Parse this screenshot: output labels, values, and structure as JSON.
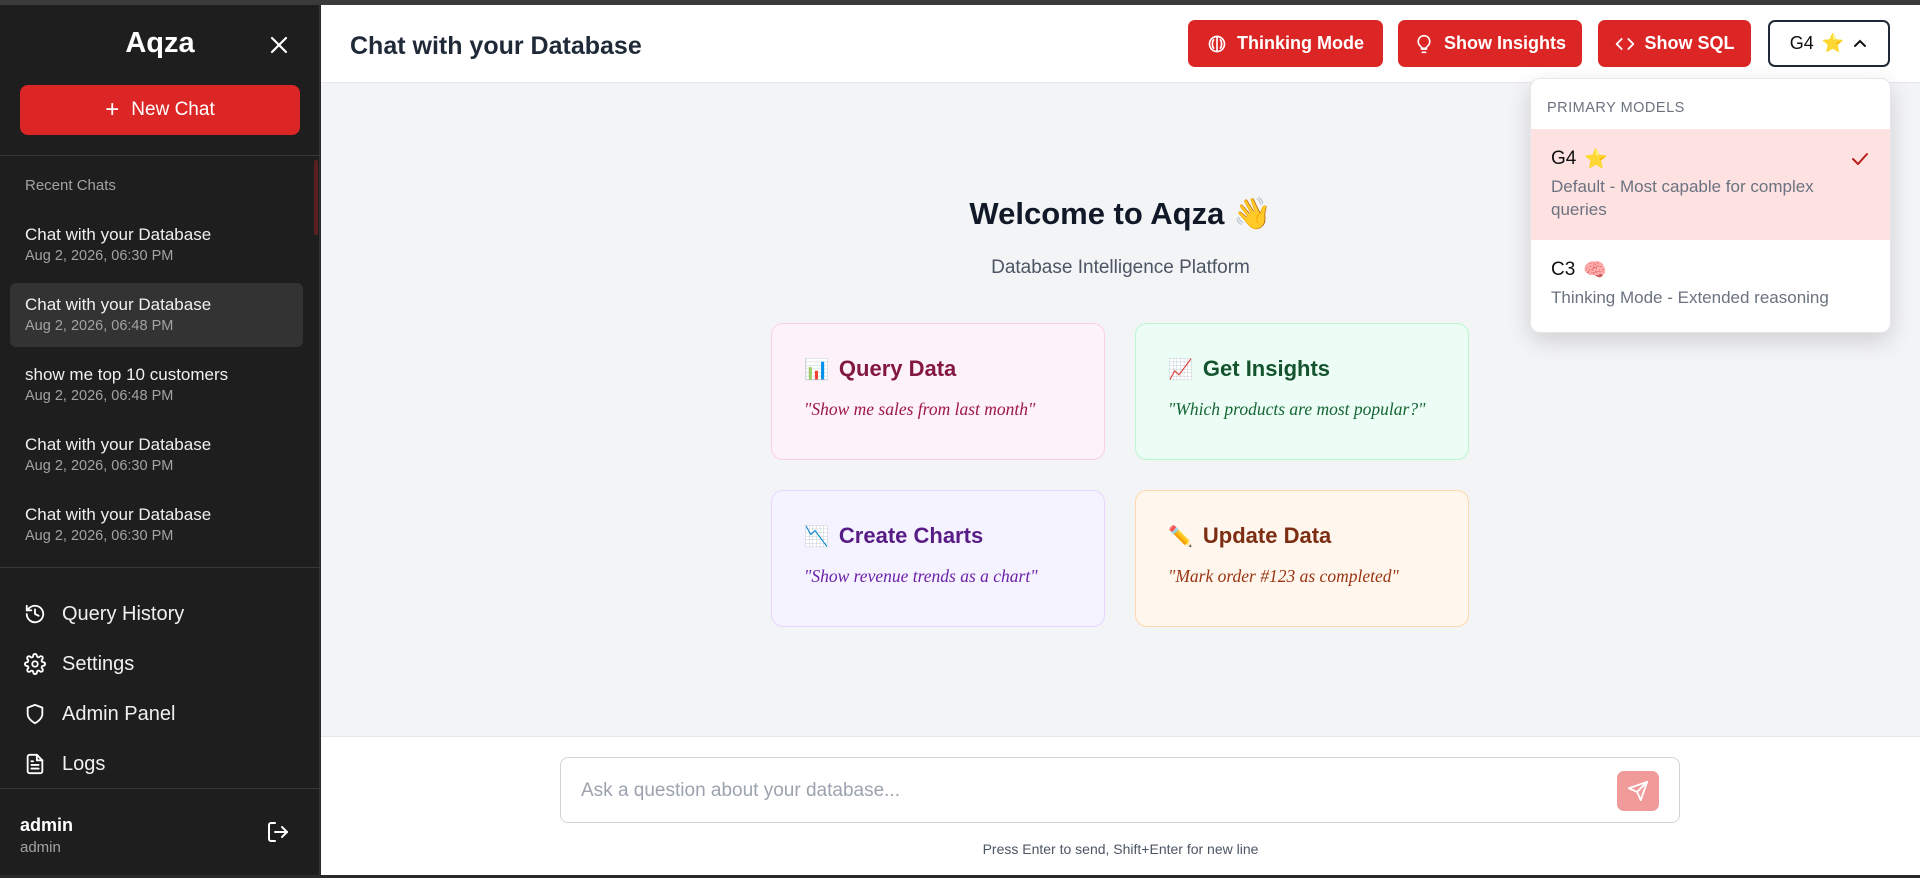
{
  "sidebar": {
    "brand": "Aqza",
    "new_chat_label": "New Chat",
    "recent_title": "Recent Chats",
    "chats": [
      {
        "title": "Chat with your Database",
        "date": "Aug 2, 2026, 06:30 PM",
        "active": false
      },
      {
        "title": "Chat with your Database",
        "date": "Aug 2, 2026, 06:48 PM",
        "active": true
      },
      {
        "title": "show me top 10 customers",
        "date": "Aug 2, 2026, 06:48 PM",
        "active": false
      },
      {
        "title": "Chat with your Database",
        "date": "Aug 2, 2026, 06:30 PM",
        "active": false
      },
      {
        "title": "Chat with your Database",
        "date": "Aug 2, 2026, 06:30 PM",
        "active": false
      }
    ],
    "nav": {
      "query_history": "Query History",
      "settings": "Settings",
      "admin_panel": "Admin Panel",
      "logs": "Logs"
    },
    "user": {
      "name": "admin",
      "role": "admin"
    }
  },
  "header": {
    "title": "Chat with your Database",
    "thinking_mode": "Thinking Mode",
    "show_insights": "Show Insights",
    "show_sql": "Show SQL",
    "model_selected": "G4",
    "model_emoji": "⭐"
  },
  "welcome": {
    "title": "Welcome to Aqza",
    "title_emoji": "👋",
    "subtitle": "Database Intelligence Platform"
  },
  "cards": {
    "query": {
      "emoji": "📊",
      "title": "Query Data",
      "example": "\"Show me sales from last month\""
    },
    "insights": {
      "emoji": "📈",
      "title": "Get Insights",
      "example": "\"Which products are most popular?\""
    },
    "charts": {
      "emoji": "📉",
      "title": "Create Charts",
      "example": "\"Show revenue trends as a chart\""
    },
    "update": {
      "emoji": "✏️",
      "title": "Update Data",
      "example": "\"Mark order #123 as completed\""
    }
  },
  "composer": {
    "placeholder": "Ask a question about your database...",
    "hint": "Press Enter to send, Shift+Enter for new line"
  },
  "model_dropdown": {
    "heading": "PRIMARY MODELS",
    "options": [
      {
        "name": "G4",
        "emoji": "⭐",
        "desc": "Default - Most capable for complex queries",
        "selected": true
      },
      {
        "name": "C3",
        "emoji": "🧠",
        "desc": "Thinking Mode - Extended reasoning",
        "selected": false
      }
    ]
  },
  "colors": {
    "accent": "#dc2626",
    "sidebar_bg": "#1e1e1e",
    "main_bg": "#f3f4f6",
    "selected_option_bg": "#fee2e2"
  }
}
